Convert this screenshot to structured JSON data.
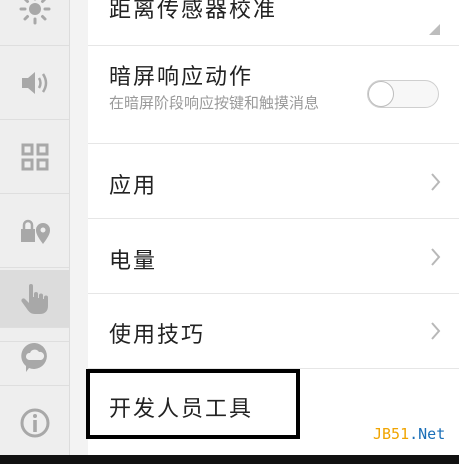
{
  "sidebar": {
    "items": [
      {
        "icon": "brightness-icon"
      },
      {
        "icon": "volume-icon"
      },
      {
        "icon": "grid-icon"
      },
      {
        "icon": "location-privacy-icon"
      },
      {
        "icon": "globe-icon"
      },
      {
        "icon": "gesture-hand-icon",
        "active": true
      },
      {
        "icon": "cloud-chat-icon"
      },
      {
        "icon": "info-icon"
      }
    ]
  },
  "settings": {
    "proximity": {
      "title": "距离传感器校准"
    },
    "screen_off": {
      "title": "暗屏响应动作",
      "subtitle": "在暗屏阶段响应按键和触摸消息",
      "toggle_on": false
    },
    "apps": {
      "title": "应用"
    },
    "battery": {
      "title": "电量"
    },
    "tips": {
      "title": "使用技巧"
    },
    "developer": {
      "title": "开发人员工具"
    }
  },
  "watermark": {
    "part1": "JB51",
    "part2": ".Net"
  },
  "colors": {
    "icon": "#a8a8a8",
    "chevron": "#b8b8b8",
    "highlight": "#000000"
  }
}
